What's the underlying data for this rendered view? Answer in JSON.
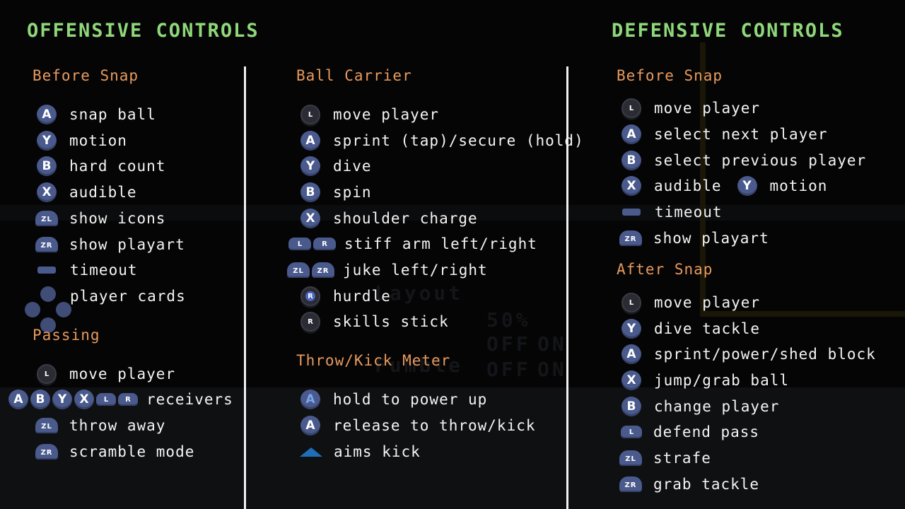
{
  "offense": {
    "title": "OFFENSIVE CONTROLS",
    "before_snap": {
      "heading": "Before Snap",
      "items": [
        {
          "icon": "a-button-icon",
          "glyph": "A",
          "label": "snap ball"
        },
        {
          "icon": "y-button-icon",
          "glyph": "Y",
          "label": "motion"
        },
        {
          "icon": "b-button-icon",
          "glyph": "B",
          "label": "hard count"
        },
        {
          "icon": "x-button-icon",
          "glyph": "X",
          "label": "audible"
        },
        {
          "icon": "zl-trigger-icon",
          "glyph": "ZL",
          "label": "show icons"
        },
        {
          "icon": "zr-trigger-icon",
          "glyph": "ZR",
          "label": "show playart"
        },
        {
          "icon": "minus-button-icon",
          "glyph": "",
          "label": "timeout"
        },
        {
          "icon": "dpad-icon",
          "glyph": "",
          "label": "player cards"
        }
      ]
    },
    "passing": {
      "heading": "Passing",
      "items": [
        {
          "icon": "left-stick-icon",
          "glyph": "L",
          "label": "move player"
        },
        {
          "icon": "receiver-buttons-icon",
          "glyphs": [
            "A",
            "B",
            "Y",
            "X",
            "L",
            "R"
          ],
          "label": "receivers"
        },
        {
          "icon": "zl-trigger-icon",
          "glyph": "ZL",
          "label": "throw away"
        },
        {
          "icon": "zr-trigger-icon",
          "glyph": "ZR",
          "label": "scramble mode"
        }
      ]
    },
    "ball_carrier": {
      "heading": "Ball Carrier",
      "items": [
        {
          "icon": "left-stick-icon",
          "glyph": "L",
          "label": "move player"
        },
        {
          "icon": "a-button-icon",
          "glyph": "A",
          "label": "sprint (tap)/secure (hold)"
        },
        {
          "icon": "y-button-icon",
          "glyph": "Y",
          "label": "dive"
        },
        {
          "icon": "b-button-icon",
          "glyph": "B",
          "label": "spin"
        },
        {
          "icon": "x-button-icon",
          "glyph": "X",
          "label": "shoulder charge"
        },
        {
          "icon": "l-r-bumpers-icon",
          "glyphs": [
            "L",
            "R"
          ],
          "label": "stiff arm left/right"
        },
        {
          "icon": "zl-zr-triggers-icon",
          "glyphs": [
            "ZL",
            "ZR"
          ],
          "label": "juke left/right"
        },
        {
          "icon": "right-stick-press-icon",
          "glyph": "R",
          "label": "hurdle"
        },
        {
          "icon": "right-stick-icon",
          "glyph": "R",
          "label": "skills stick"
        }
      ]
    },
    "meter": {
      "heading": "Throw/Kick Meter",
      "items": [
        {
          "icon": "a-button-icon",
          "glyph": "A",
          "label": "hold to power up"
        },
        {
          "icon": "a-button-icon",
          "glyph": "A",
          "label": "release to throw/kick"
        },
        {
          "icon": "triangle-aim-icon",
          "glyph": "",
          "label": "aims kick"
        }
      ]
    }
  },
  "defense": {
    "title": "DEFENSIVE CONTROLS",
    "before_snap": {
      "heading": "Before Snap",
      "items": [
        {
          "icon": "left-stick-icon",
          "glyph": "L",
          "label": "move player"
        },
        {
          "icon": "a-button-icon",
          "glyph": "A",
          "label": "select next player"
        },
        {
          "icon": "b-button-icon",
          "glyph": "B",
          "label": "select previous player"
        },
        {
          "icon": "x-button-icon",
          "glyph": "X",
          "label": "audible",
          "extra_glyph": "Y",
          "extra_label": "motion"
        },
        {
          "icon": "minus-button-icon",
          "glyph": "",
          "label": "timeout"
        },
        {
          "icon": "zr-trigger-icon",
          "glyph": "ZR",
          "label": "show playart"
        }
      ]
    },
    "after_snap": {
      "heading": "After Snap",
      "items": [
        {
          "icon": "left-stick-icon",
          "glyph": "L",
          "label": "move player"
        },
        {
          "icon": "y-button-icon",
          "glyph": "Y",
          "label": "dive tackle"
        },
        {
          "icon": "a-button-icon",
          "glyph": "A",
          "label": "sprint/power/shed block"
        },
        {
          "icon": "x-button-icon",
          "glyph": "X",
          "label": "jump/grab ball"
        },
        {
          "icon": "b-button-icon",
          "glyph": "B",
          "label": "change player"
        },
        {
          "icon": "l-bumper-icon",
          "glyph": "L",
          "label": "defend pass"
        },
        {
          "icon": "zl-trigger-icon",
          "glyph": "ZL",
          "label": "strafe"
        },
        {
          "icon": "zr-trigger-icon",
          "glyph": "ZR",
          "label": "grab tackle"
        }
      ]
    }
  },
  "background": {
    "faint_words": [
      "Layout",
      "Fumble",
      "OFF",
      "ON",
      "OFF",
      "ON",
      "50%"
    ]
  },
  "colors": {
    "title": "#8fd87a",
    "heading": "#e89a5c",
    "button": "#4a5a8c",
    "divider": "#f2f2f2"
  }
}
